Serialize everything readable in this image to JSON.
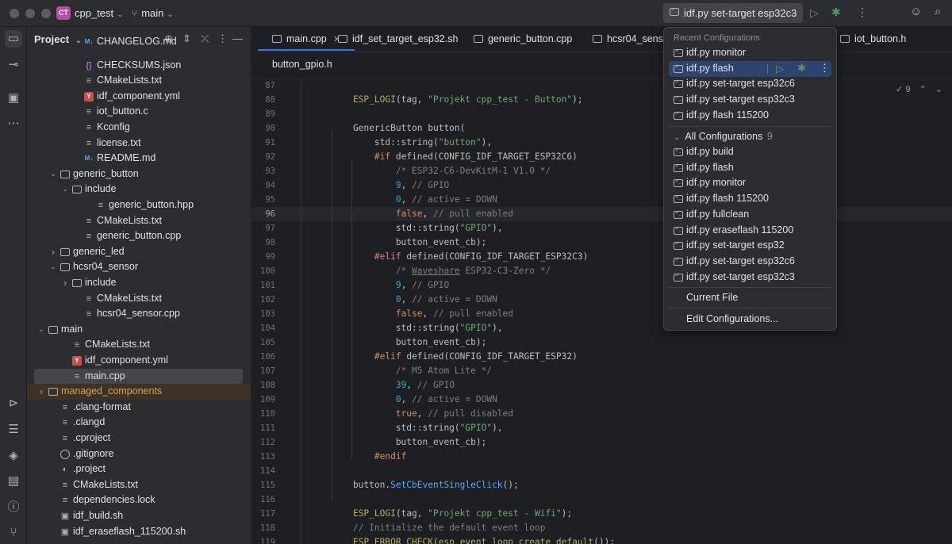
{
  "titlebar": {
    "project_badge": "CT",
    "project_name": "cpp_test",
    "branch": "main",
    "run_config": "idf.py set-target esp32c3"
  },
  "sidebar_title": "Project",
  "tree": [
    {
      "name": "CHANGELOG.md",
      "icon": "md",
      "indent": 4,
      "partial": true
    },
    {
      "name": "CHECKSUMS.json",
      "icon": "json",
      "indent": 4
    },
    {
      "name": "CMakeLists.txt",
      "icon": "text",
      "indent": 4
    },
    {
      "name": "idf_component.yml",
      "icon": "yml",
      "indent": 4
    },
    {
      "name": "iot_button.c",
      "icon": "text",
      "indent": 4
    },
    {
      "name": "Kconfig",
      "icon": "text",
      "indent": 4
    },
    {
      "name": "license.txt",
      "icon": "text",
      "indent": 4
    },
    {
      "name": "README.md",
      "icon": "md",
      "indent": 4
    },
    {
      "name": "generic_button",
      "icon": "folder",
      "indent": 2,
      "arrow": "open"
    },
    {
      "name": "include",
      "icon": "folder",
      "indent": 3,
      "arrow": "open"
    },
    {
      "name": "generic_button.hpp",
      "icon": "text",
      "indent": 5
    },
    {
      "name": "CMakeLists.txt",
      "icon": "text",
      "indent": 4
    },
    {
      "name": "generic_button.cpp",
      "icon": "text",
      "indent": 4
    },
    {
      "name": "generic_led",
      "icon": "folder",
      "indent": 2,
      "arrow": "closed"
    },
    {
      "name": "hcsr04_sensor",
      "icon": "folder",
      "indent": 2,
      "arrow": "open"
    },
    {
      "name": "include",
      "icon": "folder",
      "indent": 3,
      "arrow": "closed"
    },
    {
      "name": "CMakeLists.txt",
      "icon": "text",
      "indent": 4
    },
    {
      "name": "hcsr04_sensor.cpp",
      "icon": "text",
      "indent": 4
    },
    {
      "name": "main",
      "icon": "folder",
      "indent": 1,
      "arrow": "open"
    },
    {
      "name": "CMakeLists.txt",
      "icon": "text",
      "indent": 3
    },
    {
      "name": "idf_component.yml",
      "icon": "yml",
      "indent": 3
    },
    {
      "name": "main.cpp",
      "icon": "text",
      "indent": 3,
      "selected": true
    },
    {
      "name": "managed_components",
      "icon": "folder",
      "indent": 1,
      "arrow": "closed",
      "highlight": true
    },
    {
      "name": ".clang-format",
      "icon": "text",
      "indent": 2
    },
    {
      "name": ".clangd",
      "icon": "text",
      "indent": 2
    },
    {
      "name": ".cproject",
      "icon": "text",
      "indent": 2
    },
    {
      "name": ".gitignore",
      "icon": "git",
      "indent": 2
    },
    {
      "name": ".project",
      "icon": "project",
      "indent": 2
    },
    {
      "name": "CMakeLists.txt",
      "icon": "text",
      "indent": 2
    },
    {
      "name": "dependencies.lock",
      "icon": "text",
      "indent": 2
    },
    {
      "name": "idf_build.sh",
      "icon": "term",
      "indent": 2
    },
    {
      "name": "idf_eraseflash_115200.sh",
      "icon": "term",
      "indent": 2
    }
  ],
  "tabs": [
    "main.cpp",
    "idf_set_target_esp32.sh",
    "generic_button.cpp",
    "hcsr04_sensor",
    "iot_button.h"
  ],
  "tabs_row2": [
    "button_gpio.h"
  ],
  "inspection_count": "9",
  "code": [
    {
      "n": "87",
      "t": ""
    },
    {
      "n": "88",
      "t": "    ESP_LOGI(tag, \"Projekt cpp_test - Button\");"
    },
    {
      "n": "89",
      "t": ""
    },
    {
      "n": "90",
      "t": "    GenericButton button("
    },
    {
      "n": "91",
      "t": "        std::string(\"button\"),"
    },
    {
      "n": "92",
      "t": "        #if defined(CONFIG_IDF_TARGET_ESP32C6)"
    },
    {
      "n": "93",
      "t": "            /* ESP32-C6-DevKitM-1 V1.0 */"
    },
    {
      "n": "94",
      "t": "            9, // GPIO"
    },
    {
      "n": "95",
      "t": "            0, // active = DOWN"
    },
    {
      "n": "96",
      "t": "            false, // pull enabled",
      "cur": true
    },
    {
      "n": "97",
      "t": "            std::string(\"GPIO\"),"
    },
    {
      "n": "98",
      "t": "            button_event_cb);"
    },
    {
      "n": "99",
      "t": "        #elif defined(CONFIG_IDF_TARGET_ESP32C3)"
    },
    {
      "n": "100",
      "t": "            /* Waveshare ESP32-C3-Zero */"
    },
    {
      "n": "101",
      "t": "            9, // GPIO"
    },
    {
      "n": "102",
      "t": "            0, // active = DOWN"
    },
    {
      "n": "103",
      "t": "            false, // pull enabled"
    },
    {
      "n": "104",
      "t": "            std::string(\"GPIO\"),"
    },
    {
      "n": "105",
      "t": "            button_event_cb);"
    },
    {
      "n": "106",
      "t": "        #elif defined(CONFIG_IDF_TARGET_ESP32)"
    },
    {
      "n": "107",
      "t": "            /* M5 Atom Lite */"
    },
    {
      "n": "108",
      "t": "            39, // GPIO"
    },
    {
      "n": "109",
      "t": "            0, // active = DOWN"
    },
    {
      "n": "110",
      "t": "            true, // pull disabled"
    },
    {
      "n": "111",
      "t": "            std::string(\"GPIO\"),"
    },
    {
      "n": "112",
      "t": "            button_event_cb);"
    },
    {
      "n": "113",
      "t": "        #endif"
    },
    {
      "n": "114",
      "t": ""
    },
    {
      "n": "115",
      "t": "    button.SetCbEventSingleClick();"
    },
    {
      "n": "116",
      "t": ""
    },
    {
      "n": "117",
      "t": "    ESP_LOGI(tag, \"Projekt cpp_test - Wifi\");"
    },
    {
      "n": "118",
      "t": "    // Initialize the default event loop"
    },
    {
      "n": "119",
      "t": "    ESP_ERROR_CHECK(esp_event_loop_create_default());"
    }
  ],
  "popup": {
    "recent_title": "Recent Configurations",
    "recent": [
      "idf.py monitor",
      "idf.py flash",
      "idf.py set-target esp32c6",
      "idf.py set-target esp32c3",
      "idf.py flash 115200"
    ],
    "all_title": "All Configurations",
    "all_count": "9",
    "all": [
      "idf.py build",
      "idf.py flash",
      "idf.py monitor",
      "idf.py flash 115200",
      "idf.py fullclean",
      "idf.py eraseflash 115200",
      "idf.py set-target esp32",
      "idf.py set-target esp32c6",
      "idf.py set-target esp32c3"
    ],
    "current_file": "Current File",
    "edit": "Edit Configurations..."
  },
  "colors": {
    "accent": "#3574f0",
    "selection": "#2e436e",
    "run": "#57965c"
  }
}
